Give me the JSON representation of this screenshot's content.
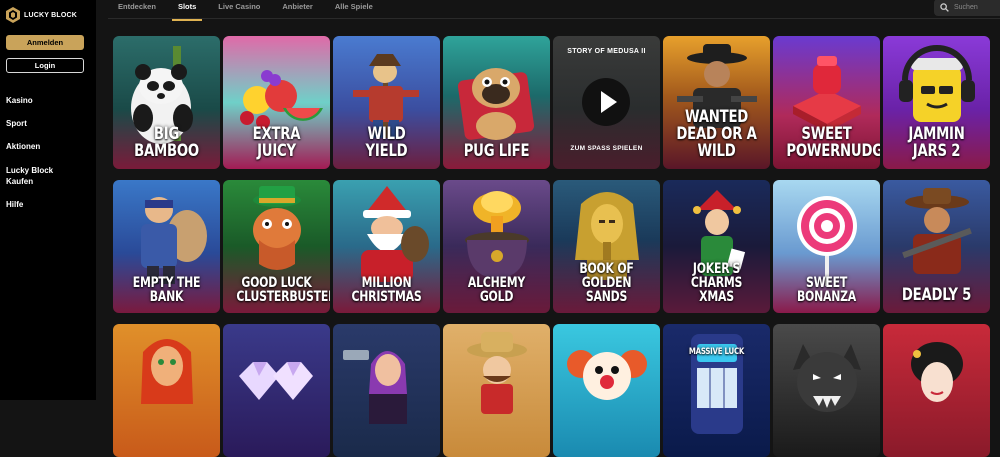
{
  "brand": {
    "name": "LUCKY BLOCK",
    "accent": "#c9a35a"
  },
  "sidebar": {
    "login_top_label": "Anmelden",
    "login_label": "Login",
    "items": [
      {
        "label": "Kasino"
      },
      {
        "label": "Sport"
      },
      {
        "label": "Aktionen"
      },
      {
        "label": "Lucky Block Kaufen"
      },
      {
        "label": "Hilfe"
      }
    ]
  },
  "tabs": [
    {
      "label": "Entdecken",
      "active": false
    },
    {
      "label": "Slots",
      "active": true
    },
    {
      "label": "Live Casino",
      "active": false
    },
    {
      "label": "Anbieter",
      "active": false
    },
    {
      "label": "Alle Spiele",
      "active": false
    }
  ],
  "search": {
    "placeholder": "Suchen",
    "icon": "search-icon"
  },
  "games": [
    {
      "title": "BIG BAMBOO"
    },
    {
      "title": "EXTRA JUICY"
    },
    {
      "title": "WILD YIELD"
    },
    {
      "title": "PUG LIFE"
    },
    {
      "title": "",
      "overlay_top": "STORY OF MEDUSA II",
      "overlay_bottom": "ZUM SPASS SPIELEN"
    },
    {
      "title": "WANTED\nDEAD OR A WILD"
    },
    {
      "title": "SWEET\nPOWERNUDGE"
    },
    {
      "title": "JAMMIN JARS 2"
    },
    {
      "title": "EMPTY THE BANK"
    },
    {
      "title": "GOOD LUCK\nCLUSTERBUSTER"
    },
    {
      "title": "MILLION\nCHRISTMAS"
    },
    {
      "title": "ALCHEMY GOLD"
    },
    {
      "title": "BOOK OF\nGOLDEN SANDS"
    },
    {
      "title": "JOKER'S CHARMS\nXMAS"
    },
    {
      "title": "SWEET BONANZA"
    },
    {
      "title": "DEADLY 5"
    },
    {
      "title": ""
    },
    {
      "title": ""
    },
    {
      "title": ""
    },
    {
      "title": ""
    },
    {
      "title": ""
    },
    {
      "title": "MASSIVE LUCK"
    },
    {
      "title": ""
    },
    {
      "title": ""
    }
  ]
}
